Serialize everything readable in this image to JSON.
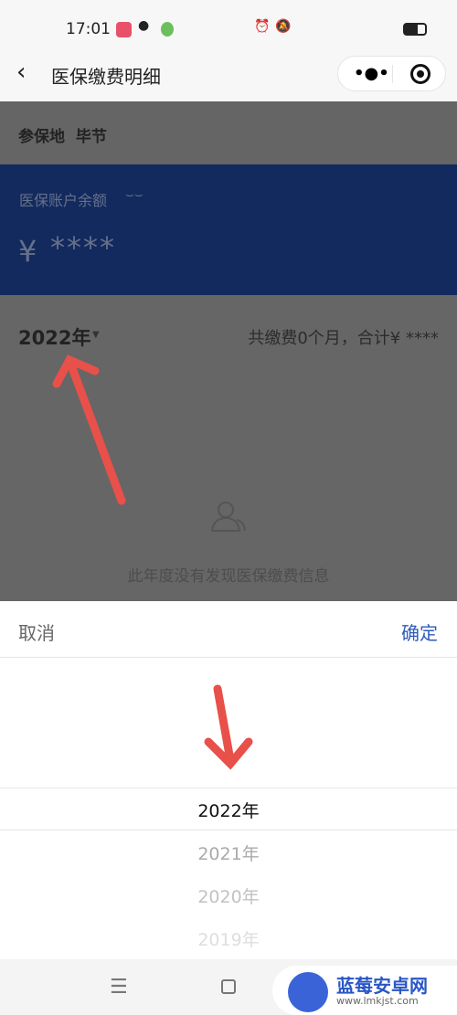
{
  "status_bar": {
    "time": "17:01"
  },
  "nav": {
    "title": "医保缴费明细"
  },
  "location": {
    "label": "参保地",
    "value": "毕节"
  },
  "balance": {
    "label": "医保账户余额",
    "currency": "¥",
    "amount": "****"
  },
  "year_filter": {
    "selected": "2022年",
    "summary": "共缴费0个月，合计¥ ****"
  },
  "empty": {
    "message": "此年度没有发现医保缴费信息"
  },
  "picker": {
    "cancel": "取消",
    "confirm": "确定",
    "options": [
      "2022年",
      "2021年",
      "2020年",
      "2019年"
    ],
    "selected_index": 0
  },
  "watermark": {
    "brand": "蓝莓安卓网",
    "url": "www.lmkjst.com"
  },
  "colors": {
    "accent": "#2f5bb7",
    "banner": "#132a5e",
    "annotation": "#e8504a"
  }
}
